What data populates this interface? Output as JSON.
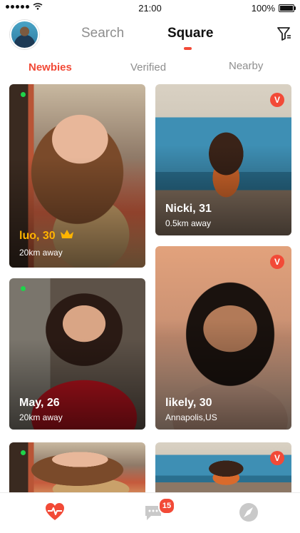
{
  "status_bar": {
    "time": "21:00",
    "battery": "100%",
    "battery_level": 1.0
  },
  "header": {
    "tabs": [
      "Search",
      "Square"
    ],
    "active_tab": "Square",
    "filter_icon": "filter-icon",
    "avatar_icon": "avatar"
  },
  "subtabs": {
    "items": [
      "Newbies",
      "Verified",
      "Nearby"
    ],
    "active": "Newbies"
  },
  "cards": [
    {
      "name": "luo, 30",
      "subtitle": "20km away",
      "online": true,
      "crown": true
    },
    {
      "name": "Nicki, 31",
      "subtitle": "0.5km away",
      "verified": "V"
    },
    {
      "name": "May, 26",
      "subtitle": "20km away",
      "online": true
    },
    {
      "name": "likely, 30",
      "subtitle": "Annapolis,US",
      "verified": "V"
    },
    {
      "online": true
    },
    {
      "verified": "V"
    }
  ],
  "tabbar": {
    "items": [
      "heart-pulse-icon",
      "chat-icon",
      "discover-icon"
    ],
    "messages_badge": "15"
  },
  "colors": {
    "accent": "#f24a37",
    "online": "#1fd34a",
    "crown": "#ffb400",
    "inactive": "#8e8e8e"
  }
}
